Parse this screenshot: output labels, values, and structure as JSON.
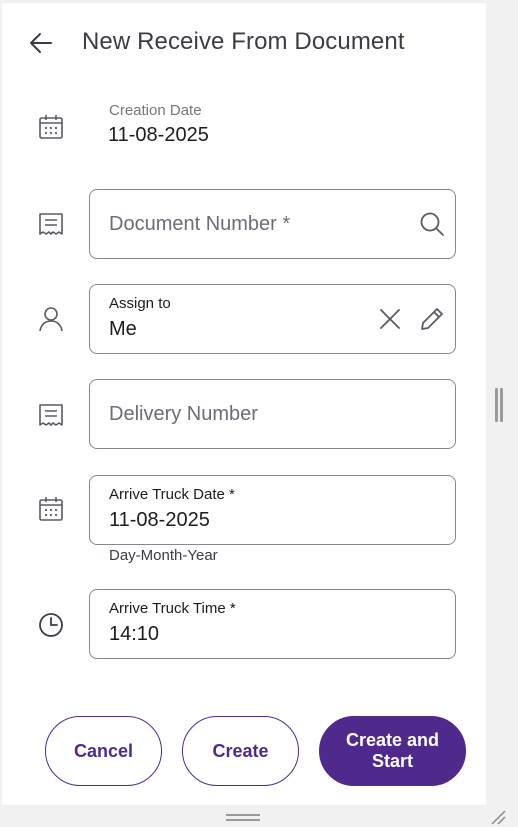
{
  "header": {
    "title": "New Receive From Document",
    "back_icon": "arrow-left-icon"
  },
  "creation_date": {
    "label": "Creation Date",
    "value": "11-08-2025",
    "icon": "calendar-icon"
  },
  "document_number": {
    "placeholder": "Document Number *",
    "icon": "document-icon",
    "action_icon": "search-icon"
  },
  "assign_to": {
    "label": "Assign to",
    "value": "Me",
    "icon": "user-icon",
    "clear_icon": "close-icon",
    "edit_icon": "pencil-icon"
  },
  "delivery_number": {
    "placeholder": "Delivery Number",
    "icon": "document-icon"
  },
  "arrive_truck_date": {
    "label": "Arrive Truck Date *",
    "value": "11-08-2025",
    "helper": "Day-Month-Year",
    "icon": "calendar-icon"
  },
  "arrive_truck_time": {
    "label": "Arrive Truck Time *",
    "value": "14:10",
    "icon": "clock-icon"
  },
  "actions": {
    "cancel": "Cancel",
    "create": "Create",
    "create_and_start_line1": "Create and",
    "create_and_start_line2": "Start"
  },
  "colors": {
    "primary": "#4f2a8c",
    "border": "#8a8690",
    "icon": "#5b5963"
  }
}
